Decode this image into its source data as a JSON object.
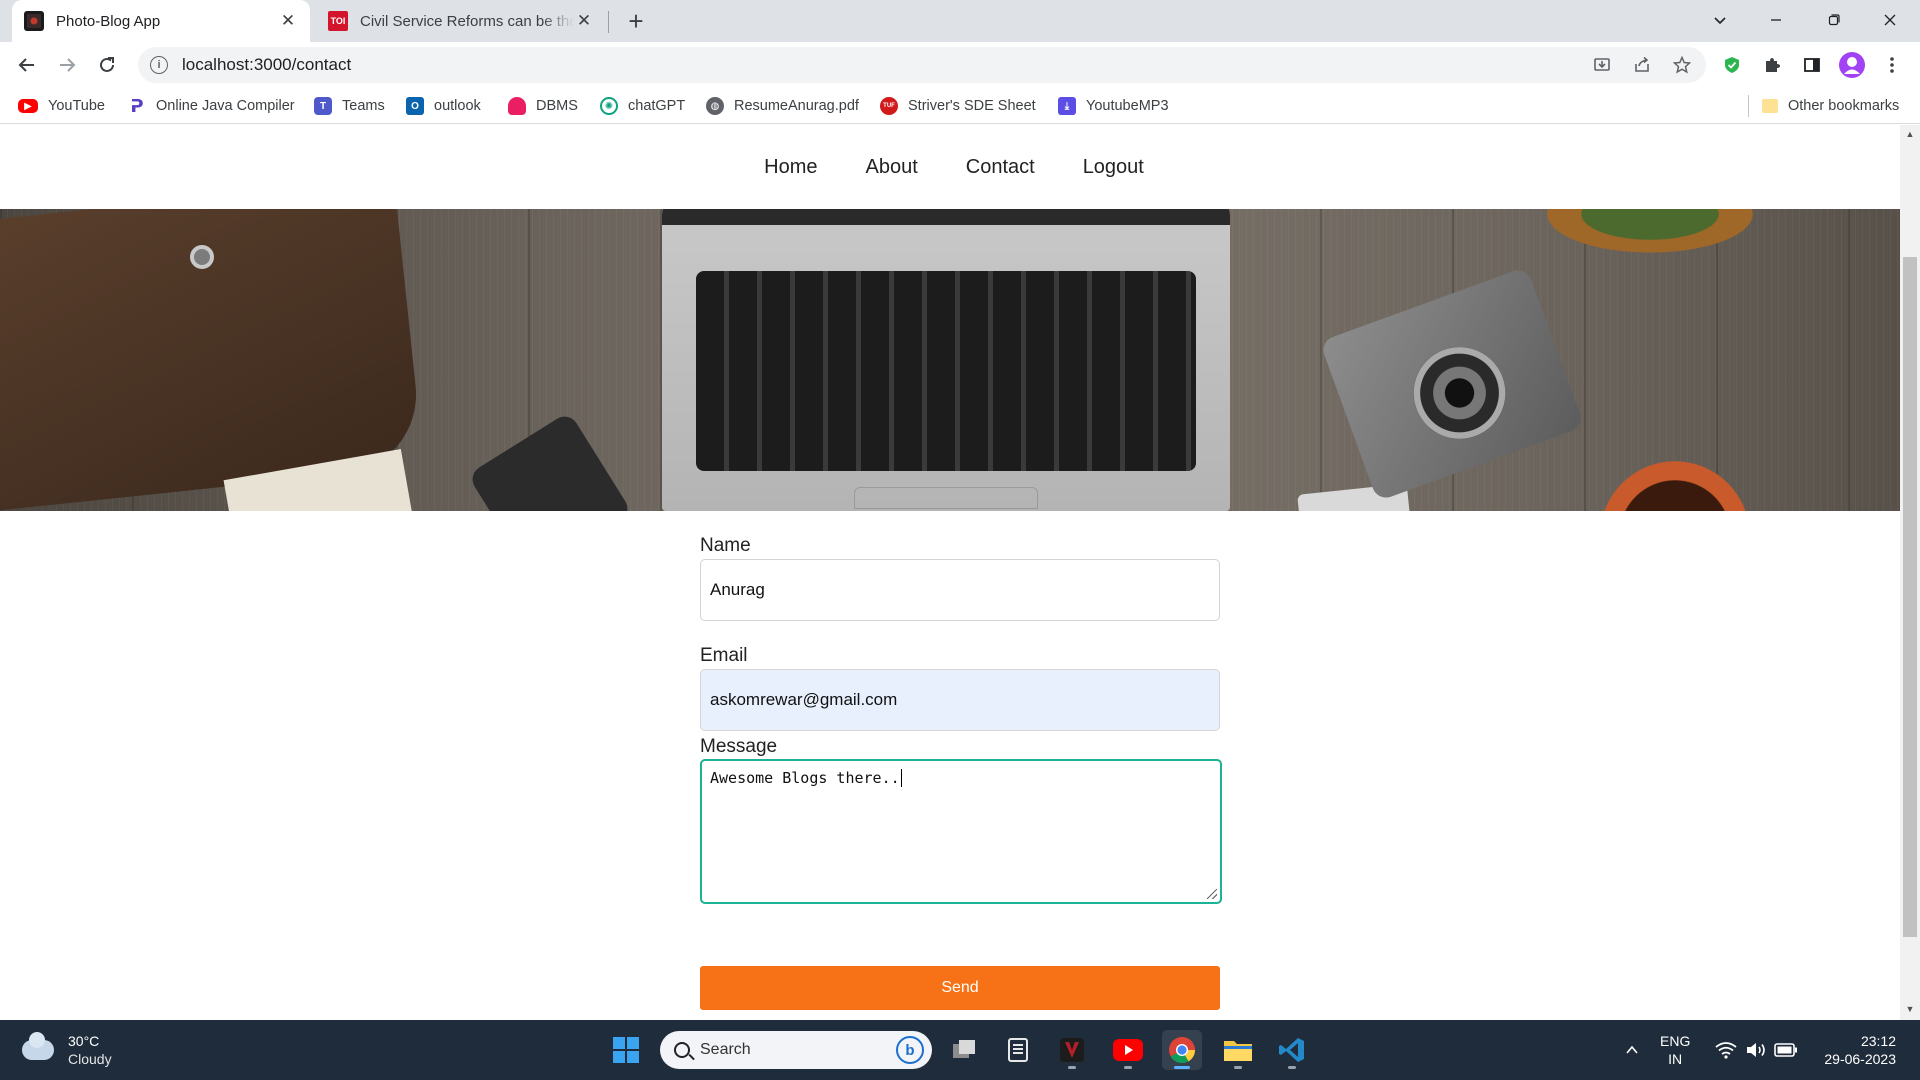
{
  "browser": {
    "tabs": [
      {
        "title": "Photo-Blog App",
        "active": true
      },
      {
        "title": "Civil Service Reforms can be the",
        "favicon_text": "TOI",
        "active": false
      }
    ],
    "url": "localhost:3000/contact",
    "bookmarks": [
      {
        "label": "YouTube",
        "icon": "youtube-icon",
        "color": "#ff0000"
      },
      {
        "label": "Online Java Compiler",
        "icon": "code-icon",
        "color": "#5b3cc4"
      },
      {
        "label": "Teams",
        "icon": "teams-icon",
        "color": "#5059c9"
      },
      {
        "label": "outlook",
        "icon": "outlook-icon",
        "color": "#0a64ad"
      },
      {
        "label": "DBMS",
        "icon": "dbms-icon",
        "color": "#e91e63"
      },
      {
        "label": "chatGPT",
        "icon": "chatgpt-icon",
        "color": "#10a37f"
      },
      {
        "label": "ResumeAnurag.pdf",
        "icon": "globe-icon",
        "color": "#5f6368"
      },
      {
        "label": "Striver's SDE Sheet",
        "icon": "tuf-icon",
        "color": "#d11a1a"
      },
      {
        "label": "YoutubeMP3",
        "icon": "download-icon",
        "color": "#5c4ee5"
      }
    ],
    "other_bookmarks": "Other bookmarks"
  },
  "site": {
    "nav": [
      "Home",
      "About",
      "Contact",
      "Logout"
    ],
    "form": {
      "name_label": "Name",
      "name_value": "Anurag",
      "email_label": "Email",
      "email_value": "askomrewar@gmail.com",
      "message_label": "Message",
      "message_value": "Awesome Blogs there..",
      "send_label": "Send"
    },
    "accent_color": "#f77216",
    "focus_color": "#1ab394"
  },
  "taskbar": {
    "weather_temp": "30°C",
    "weather_desc": "Cloudy",
    "search_placeholder": "Search",
    "lang": "ENG",
    "region": "IN",
    "time": "23:12",
    "date": "29-06-2023"
  }
}
